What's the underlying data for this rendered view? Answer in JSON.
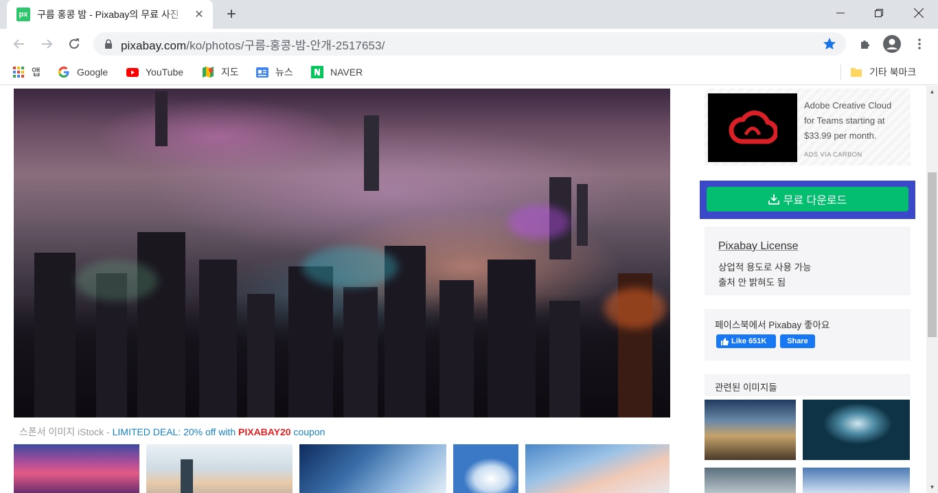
{
  "browser": {
    "tab": {
      "favicon": "px",
      "title": "구름 홍콩 밤 - Pixabay의 무료 사진"
    },
    "url": {
      "host": "pixabay.com",
      "path": "/ko/photos/구름-홍콩-밤-안개-2517653/"
    },
    "bookmarks": [
      {
        "icon": "apps-grid-icon",
        "label": "앱"
      },
      {
        "icon": "google-icon",
        "label": "Google"
      },
      {
        "icon": "youtube-icon",
        "label": "YouTube"
      },
      {
        "icon": "maps-icon",
        "label": "지도"
      },
      {
        "icon": "news-icon",
        "label": "뉴스"
      },
      {
        "icon": "naver-icon",
        "label": "NAVER"
      }
    ],
    "other_bookmarks": "기타 북마크"
  },
  "main": {
    "sponsor": {
      "prefix": "스폰서 이미지 iStock - ",
      "deal": "LIMITED DEAL: 20% off with ",
      "code": "PIXABAY20",
      "suffix": " coupon"
    }
  },
  "sidebar": {
    "ad": {
      "text": "Adobe Creative Cloud for Teams starting at $33.99 per month.",
      "via": "ADS VIA CARBON"
    },
    "download_label": "무료 다운로드",
    "license": {
      "title": "Pixabay License",
      "line1": "상업적 용도로 사용 가능",
      "line2": "출처 안 밝혀도 됨"
    },
    "facebook": {
      "title": "페이스북에서 Pixabay 좋아요",
      "like": "Like 651K",
      "share": "Share"
    },
    "related_title": "관련된 이미지들"
  },
  "colors": {
    "download_green": "#02be6e",
    "highlight_blue": "#3b48c9",
    "facebook_blue": "#1877f2",
    "deal_blue": "#1a80c0",
    "coupon_red": "#e02020"
  }
}
